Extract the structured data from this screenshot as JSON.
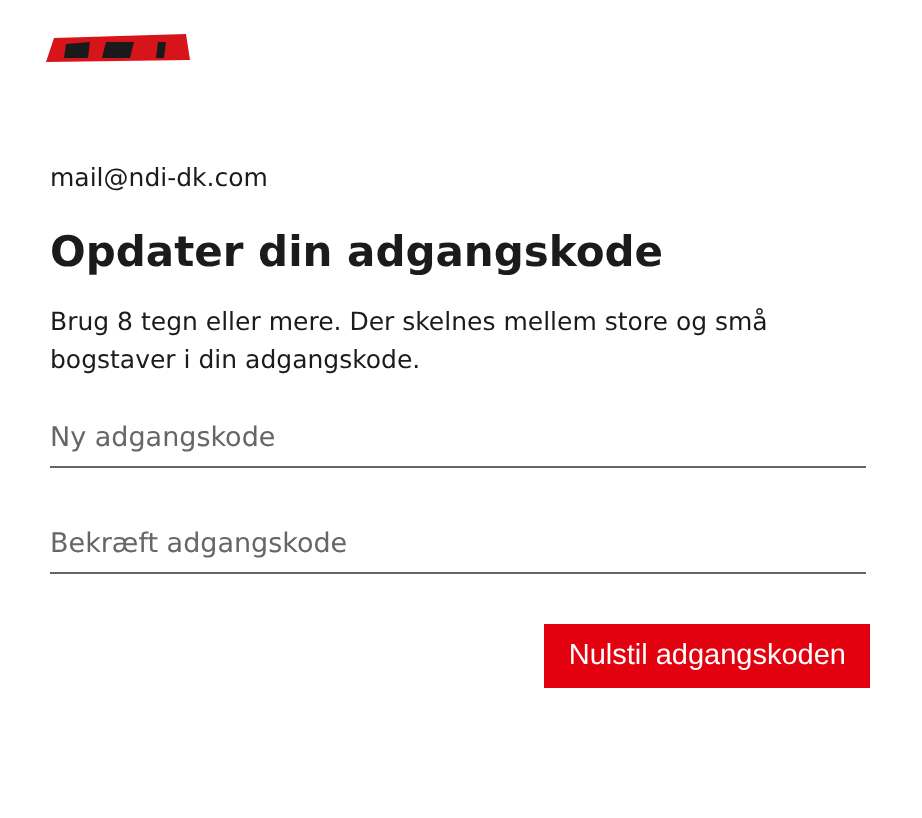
{
  "account": {
    "email": "mail@ndi-dk.com"
  },
  "heading": "Opdater din adgangskode",
  "description": "Brug 8 tegn eller mere. Der skelnes mellem store og små bogstaver i din adgangskode.",
  "fields": [
    {
      "placeholder": "Ny adgangskode"
    },
    {
      "placeholder": "Bekræft adgangskode"
    }
  ],
  "submit_button": "Nulstil adgangskoden"
}
